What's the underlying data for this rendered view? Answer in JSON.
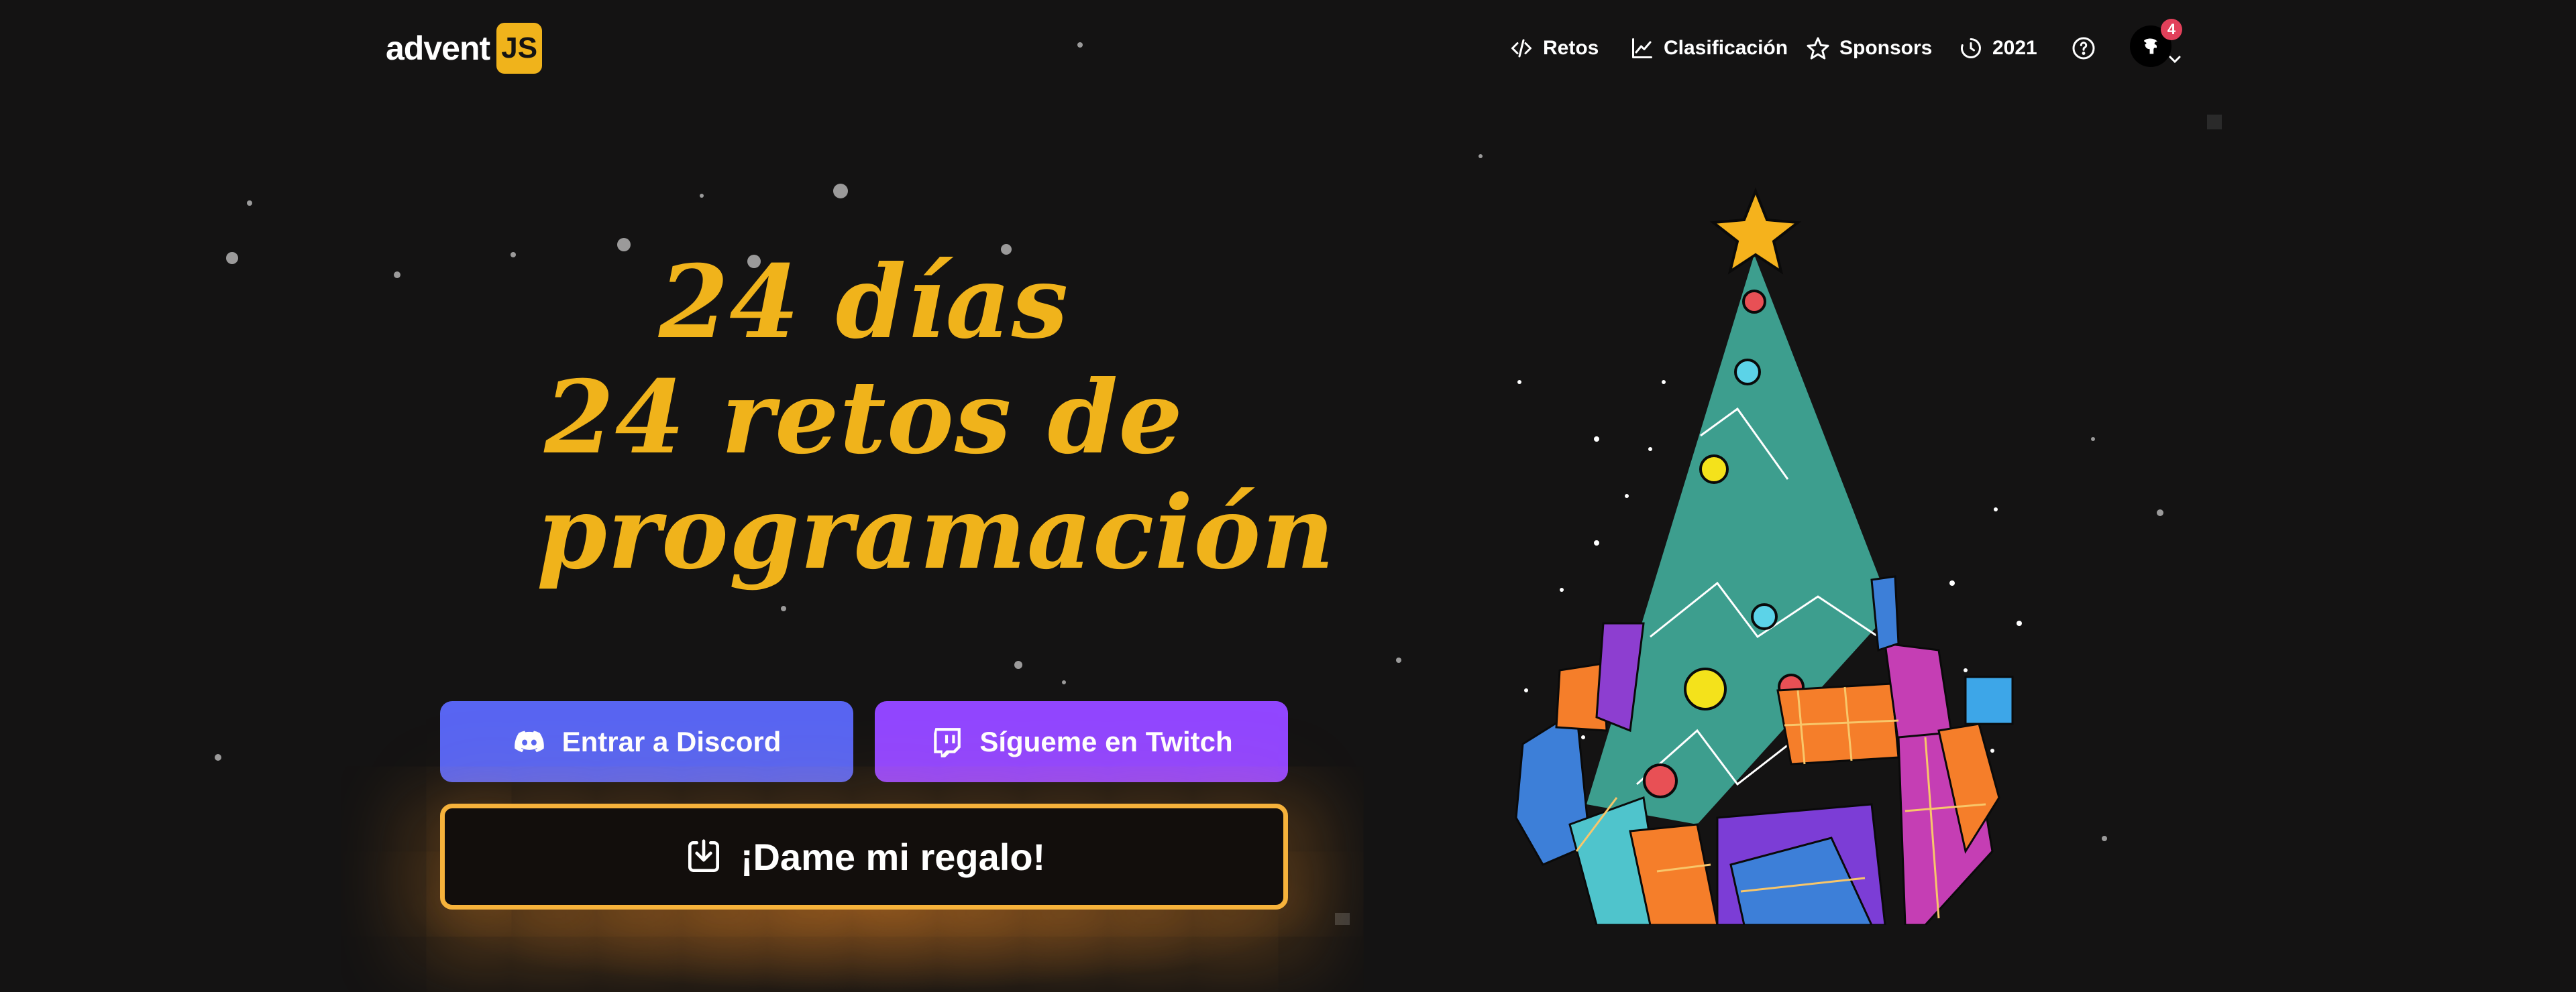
{
  "header": {
    "logo_text": "advent",
    "logo_badge": "JS",
    "nav": [
      {
        "label": "Retos",
        "icon": "code-icon"
      },
      {
        "label": "Clasificación",
        "icon": "chart-line-icon"
      },
      {
        "label": "Sponsors",
        "icon": "star-icon"
      },
      {
        "label": "2021",
        "icon": "history-clock-icon"
      }
    ],
    "help_icon": "question-circle-icon",
    "notification_count": "4"
  },
  "hero": {
    "title_line1": "24 días",
    "title_line2": "24 retos de",
    "title_line3": "programación"
  },
  "buttons": {
    "discord_label": "Entrar a Discord",
    "twitch_label": "Sígueme en Twitch",
    "gift_label": "¡Dame mi regalo!"
  },
  "colors": {
    "background": "#141313",
    "accent": "#f0b31b",
    "discord": "#5865f2",
    "twitch": "#9146ff",
    "gift_border": "#f6b23b"
  }
}
